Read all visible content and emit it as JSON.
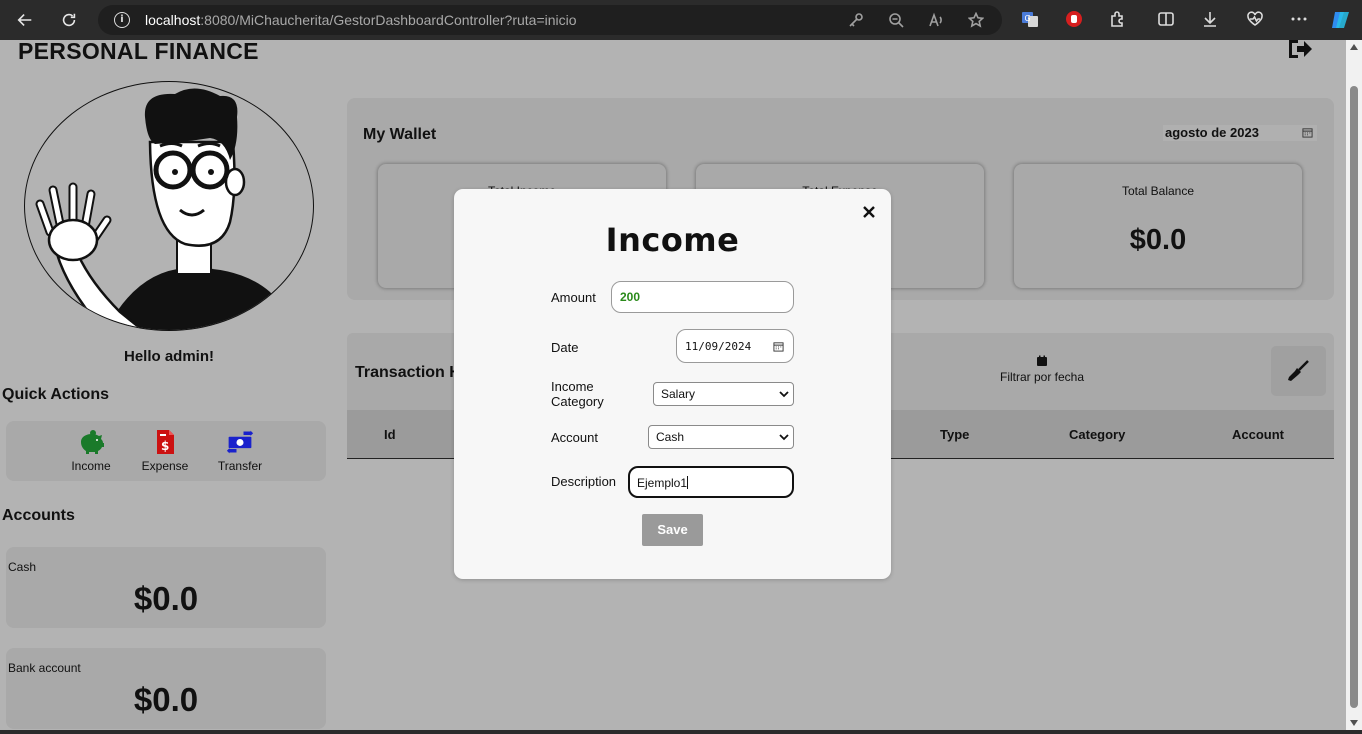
{
  "browser": {
    "url_host": "localhost",
    "url_rest": ":8080/MiChaucherita/GestorDashboardController?ruta=inicio"
  },
  "app": {
    "title": "PERSONAL FINANCE",
    "greeting": "Hello admin!"
  },
  "quick_actions": {
    "title": "Quick Actions",
    "items": [
      {
        "label": "Income",
        "icon": "piggy-bank-icon",
        "color": "#1a7a2a"
      },
      {
        "label": "Expense",
        "icon": "invoice-dollar-icon",
        "color": "#cc1111"
      },
      {
        "label": "Transfer",
        "icon": "money-transfer-icon",
        "color": "#1a22cc"
      }
    ]
  },
  "accounts": {
    "title": "Accounts",
    "items": [
      {
        "name": "Cash",
        "balance": "$0.0"
      },
      {
        "name": "Bank account",
        "balance": "$0.0"
      }
    ]
  },
  "wallet": {
    "title": "My Wallet",
    "month": "agosto de 2023",
    "stats": [
      {
        "label": "Total Income",
        "value": ""
      },
      {
        "label": "Total Expense",
        "value": ""
      },
      {
        "label": "Total Balance",
        "value": "$0.0"
      }
    ]
  },
  "history": {
    "title": "Transaction History",
    "filter_label": "Filtrar por fecha",
    "columns": [
      "Id",
      "Type",
      "Category",
      "Account"
    ]
  },
  "modal": {
    "title": "Income",
    "amount_label": "Amount",
    "amount_value": "200",
    "date_label": "Date",
    "date_value": "11/09/2024",
    "category_label_1": "Income",
    "category_label_2": "Category",
    "category_value": "Salary",
    "account_label": "Account",
    "account_value": "Cash",
    "description_label": "Description",
    "description_value": "Ejemplo1",
    "save_label": "Save"
  }
}
